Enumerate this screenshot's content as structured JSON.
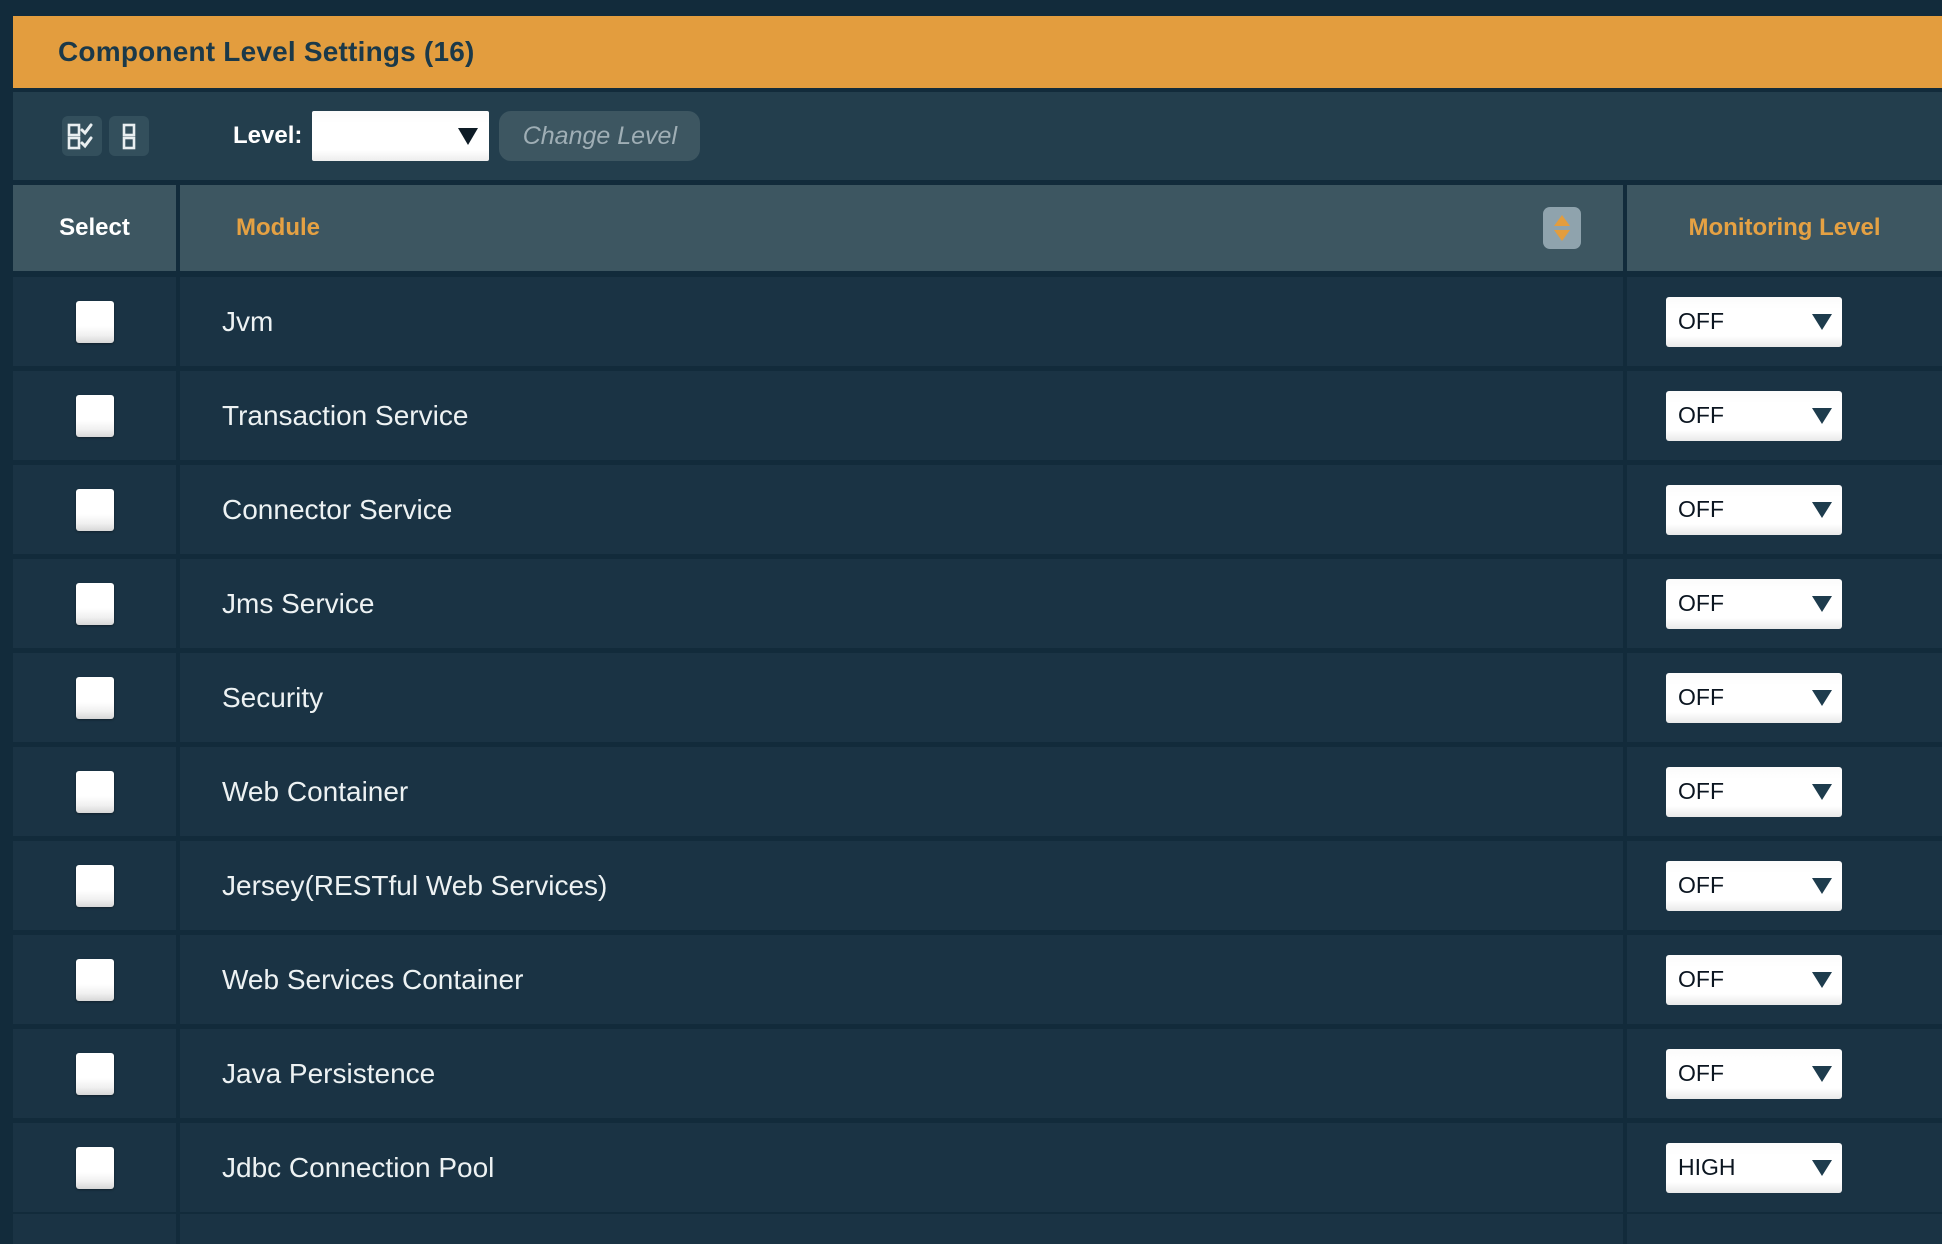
{
  "panel": {
    "title": "Component Level Settings (16)"
  },
  "toolbar": {
    "level_label": "Level:",
    "level_value": "",
    "change_level_label": "Change Level",
    "icons": [
      "select-all-icon",
      "deselect-all-icon"
    ]
  },
  "table": {
    "columns": {
      "select": "Select",
      "module": "Module",
      "monitoring_level": "Monitoring Level"
    },
    "sort_icon": "sort-up-down-icon",
    "rows": [
      {
        "module": "Jvm",
        "monitoring_level": "OFF",
        "checked": false
      },
      {
        "module": "Transaction Service",
        "monitoring_level": "OFF",
        "checked": false
      },
      {
        "module": "Connector Service",
        "monitoring_level": "OFF",
        "checked": false
      },
      {
        "module": "Jms Service",
        "monitoring_level": "OFF",
        "checked": false
      },
      {
        "module": "Security",
        "monitoring_level": "OFF",
        "checked": false
      },
      {
        "module": "Web Container",
        "monitoring_level": "OFF",
        "checked": false
      },
      {
        "module": "Jersey(RESTful Web Services)",
        "monitoring_level": "OFF",
        "checked": false
      },
      {
        "module": "Web Services Container",
        "monitoring_level": "OFF",
        "checked": false
      },
      {
        "module": "Java Persistence",
        "monitoring_level": "OFF",
        "checked": false
      },
      {
        "module": "Jdbc Connection Pool",
        "monitoring_level": "HIGH",
        "checked": false
      }
    ]
  },
  "colors": {
    "accent_orange": "#E39D3E",
    "page_background": "#122B3B",
    "toolbar_background": "#233E4D",
    "header_background": "#3D5661",
    "row_background": "#1A3344",
    "title_text": "#1B3949"
  }
}
